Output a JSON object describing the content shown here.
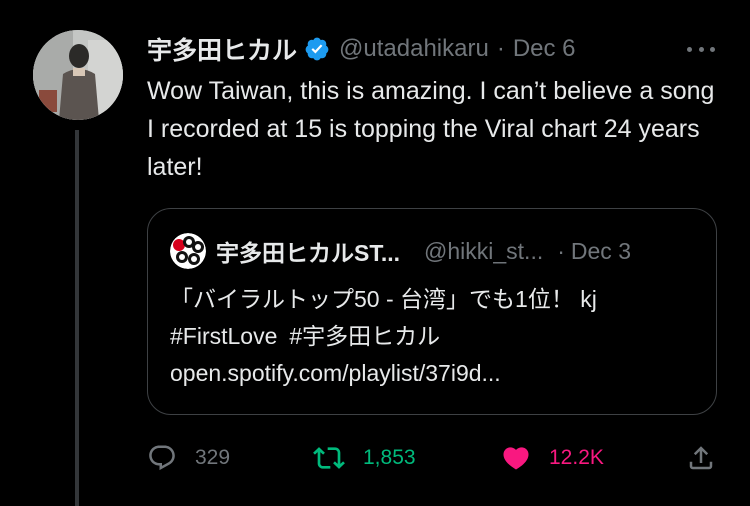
{
  "author": {
    "display_name": "宇多田ヒカル",
    "handle": "@utadahikaru",
    "separator": "·",
    "date": "Dec 6",
    "verified": true
  },
  "tweet_text": "Wow Taiwan, this is amazing. I can’t believe a song I recorded at 15 is topping the Viral chart 24 years later!",
  "quoted_tweet": {
    "display_name": "宇多田ヒカルST...",
    "handle": "@hikki_st...",
    "separator": "·",
    "date": "Dec 3",
    "line1": "「バイラルトップ50 - 台湾」でも1位！ kj",
    "hashtag1": "#FirstLove",
    "hashtag2": "#宇多田ヒカル",
    "link": "open.spotify.com/playlist/37i9d..."
  },
  "actions": {
    "replies": "329",
    "retweets": "1,853",
    "likes": "12.2K"
  },
  "colors": {
    "background": "#000000",
    "text": "#e7e9ea",
    "muted": "#71767b",
    "verified": "#1d9bf0",
    "retweet": "#00ba7c",
    "like": "#f91880",
    "border": "#3e4144"
  },
  "icons": {
    "verified": "verified-badge-icon",
    "more": "more-dots-icon",
    "reply": "reply-bubble-icon",
    "retweet": "retweet-arrows-icon",
    "like": "heart-filled-icon",
    "share": "share-upload-icon"
  }
}
